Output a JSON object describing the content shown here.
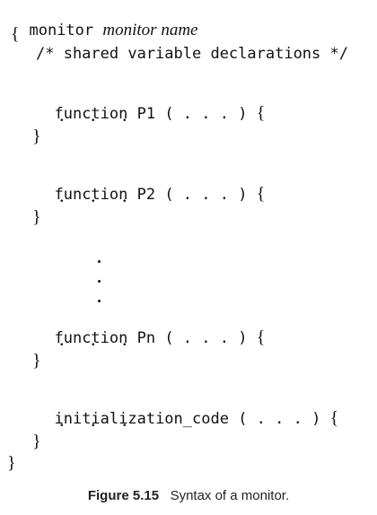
{
  "code": {
    "keyword_monitor": "monitor",
    "monitor_name": "monitor name",
    "open_brace": "{",
    "comment": "/* shared variable declarations */",
    "functions": [
      {
        "name": "function P1",
        "args": "( . . . )",
        "open": "{",
        "body": ". . .",
        "close": "}"
      },
      {
        "name": "function P2",
        "args": "( . . . )",
        "open": "{",
        "body": ". . .",
        "close": "}"
      },
      {
        "name": "function Pn",
        "args": "( . . . )",
        "open": "{",
        "body": ". . .",
        "close": "}"
      }
    ],
    "init": {
      "name": "initialization_code",
      "args": "( . . . )",
      "open": "{",
      "body": ". . .",
      "close": "}"
    },
    "close_brace": "}"
  },
  "caption": {
    "label": "Figure 5.15",
    "text": "Syntax of a monitor."
  }
}
